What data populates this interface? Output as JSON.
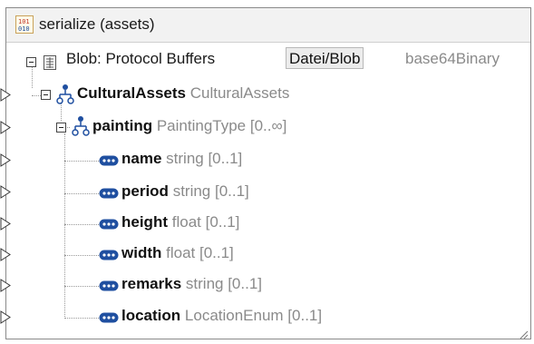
{
  "component": {
    "title": "serialize (assets)",
    "title_icon": "binary-serialize-icon"
  },
  "tree": {
    "root": {
      "label": "Blob: Protocol Buffers",
      "button": "Datei/Blob",
      "encoding": "base64Binary",
      "icon": "grid-document-icon"
    },
    "cultural_assets": {
      "name": "CulturalAssets",
      "type": "CulturalAssets",
      "icon": "hierarchy-icon"
    },
    "painting": {
      "name": "painting",
      "type": "PaintingType [0..∞]",
      "icon": "hierarchy-icon"
    },
    "fields": [
      {
        "name": "name",
        "type": "string [0..1]"
      },
      {
        "name": "period",
        "type": "string [0..1]"
      },
      {
        "name": "height",
        "type": "float [0..1]"
      },
      {
        "name": "width",
        "type": "float [0..1]"
      },
      {
        "name": "remarks",
        "type": "string [0..1]"
      },
      {
        "name": "location",
        "type": "LocationEnum [0..1]"
      }
    ]
  },
  "colors": {
    "accent_blue": "#1f4fa0",
    "border": "#8a8a8a",
    "type_gray": "#8a8a8a"
  }
}
